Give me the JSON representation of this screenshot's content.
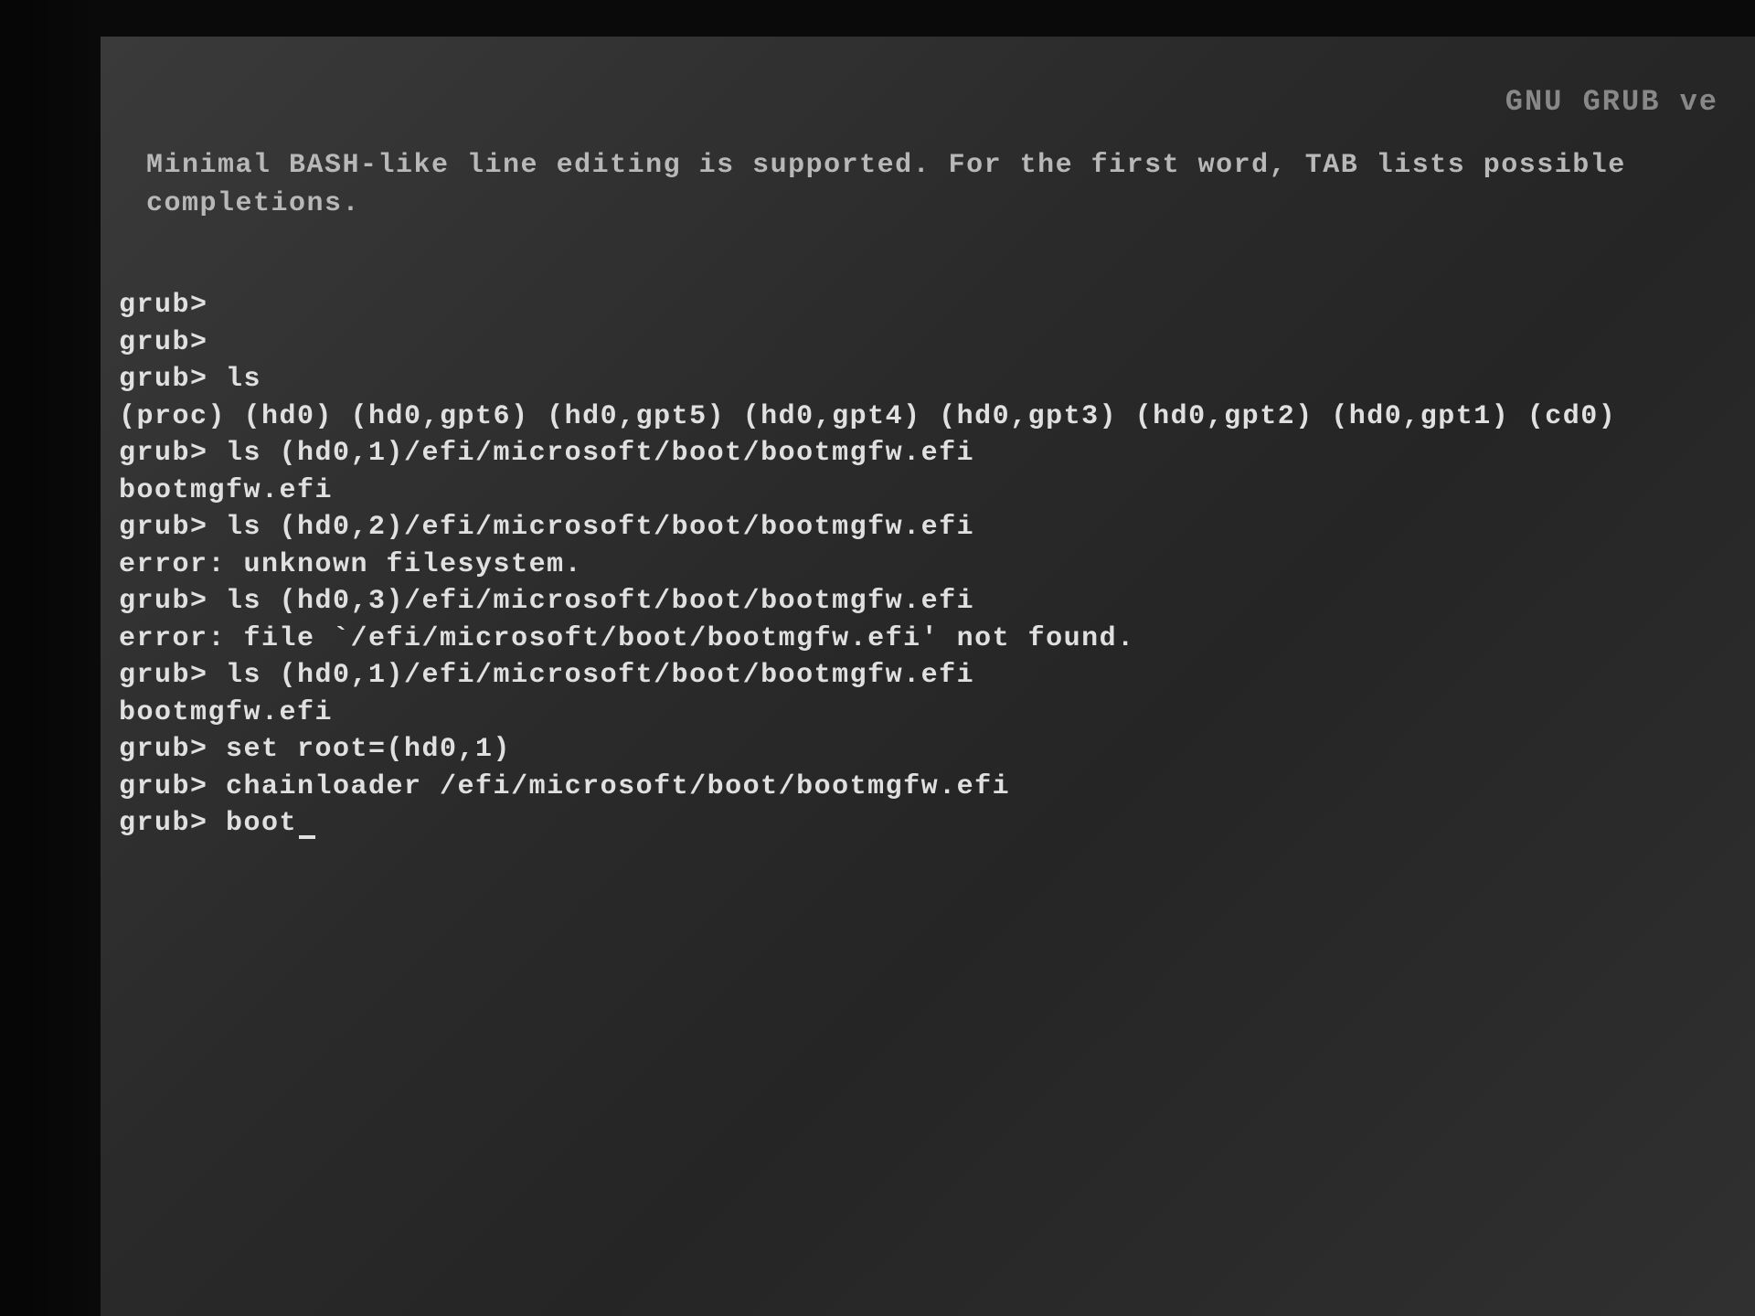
{
  "header": {
    "title": "GNU GRUB  ve"
  },
  "help": {
    "line1": "Minimal BASH-like line editing is supported. For the first word, TAB lists possible",
    "line2": "completions."
  },
  "prompt": "grub>",
  "lines": [
    {
      "type": "prompt",
      "text": ""
    },
    {
      "type": "prompt",
      "text": ""
    },
    {
      "type": "prompt",
      "text": "ls"
    },
    {
      "type": "output",
      "text": "(proc) (hd0) (hd0,gpt6) (hd0,gpt5) (hd0,gpt4) (hd0,gpt3) (hd0,gpt2) (hd0,gpt1) (cd0)"
    },
    {
      "type": "prompt",
      "text": "ls (hd0,1)/efi/microsoft/boot/bootmgfw.efi"
    },
    {
      "type": "output",
      "text": "bootmgfw.efi"
    },
    {
      "type": "prompt",
      "text": "ls (hd0,2)/efi/microsoft/boot/bootmgfw.efi"
    },
    {
      "type": "output",
      "text": "error: unknown filesystem."
    },
    {
      "type": "prompt",
      "text": "ls (hd0,3)/efi/microsoft/boot/bootmgfw.efi"
    },
    {
      "type": "output",
      "text": "error: file `/efi/microsoft/boot/bootmgfw.efi' not found."
    },
    {
      "type": "prompt",
      "text": "ls (hd0,1)/efi/microsoft/boot/bootmgfw.efi"
    },
    {
      "type": "output",
      "text": "bootmgfw.efi"
    },
    {
      "type": "prompt",
      "text": "set root=(hd0,1)"
    },
    {
      "type": "prompt",
      "text": "chainloader /efi/microsoft/boot/bootmgfw.efi"
    },
    {
      "type": "prompt",
      "text": "boot",
      "cursor": true
    }
  ]
}
